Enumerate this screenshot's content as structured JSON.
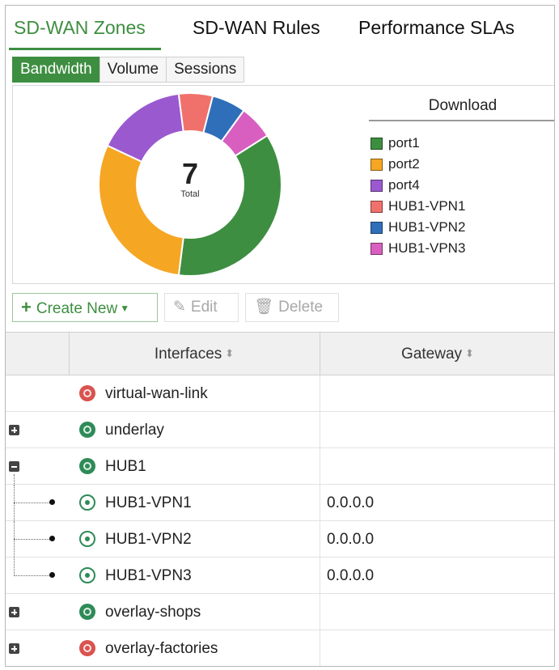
{
  "top_tabs": [
    {
      "label": "SD-WAN Zones",
      "active": true
    },
    {
      "label": "SD-WAN Rules",
      "active": false
    },
    {
      "label": "Performance SLAs",
      "active": false
    }
  ],
  "sub_tabs": [
    {
      "label": "Bandwidth",
      "active": true
    },
    {
      "label": "Volume",
      "active": false
    },
    {
      "label": "Sessions",
      "active": false
    }
  ],
  "chart_data": {
    "type": "pie",
    "center_value": "7",
    "center_label": "Total",
    "legend_title": "Download",
    "categories": [
      "port1",
      "port2",
      "port4",
      "HUB1-VPN1",
      "HUB1-VPN2",
      "HUB1-VPN3"
    ],
    "values": [
      36,
      30,
      16,
      6,
      6,
      6
    ],
    "colors": [
      "#3e8e41",
      "#f5a623",
      "#9b59d0",
      "#f0716b",
      "#2f6fba",
      "#d85fbf"
    ]
  },
  "toolbar": {
    "create_label": "Create New",
    "edit_label": "Edit",
    "delete_label": "Delete"
  },
  "table": {
    "columns": [
      "Interfaces",
      "Gateway"
    ],
    "rows": [
      {
        "name": "virtual-wan-link",
        "gateway": "",
        "kind": "zone-red"
      },
      {
        "name": "underlay",
        "gateway": "",
        "kind": "zone-green"
      },
      {
        "name": "HUB1",
        "gateway": "",
        "kind": "zone-green"
      },
      {
        "name": "HUB1-VPN1",
        "gateway": "0.0.0.0",
        "kind": "vpn"
      },
      {
        "name": "HUB1-VPN2",
        "gateway": "0.0.0.0",
        "kind": "vpn"
      },
      {
        "name": "HUB1-VPN3",
        "gateway": "0.0.0.0",
        "kind": "vpn"
      },
      {
        "name": "overlay-shops",
        "gateway": "",
        "kind": "zone-green"
      },
      {
        "name": "overlay-factories",
        "gateway": "",
        "kind": "zone-red"
      }
    ]
  }
}
